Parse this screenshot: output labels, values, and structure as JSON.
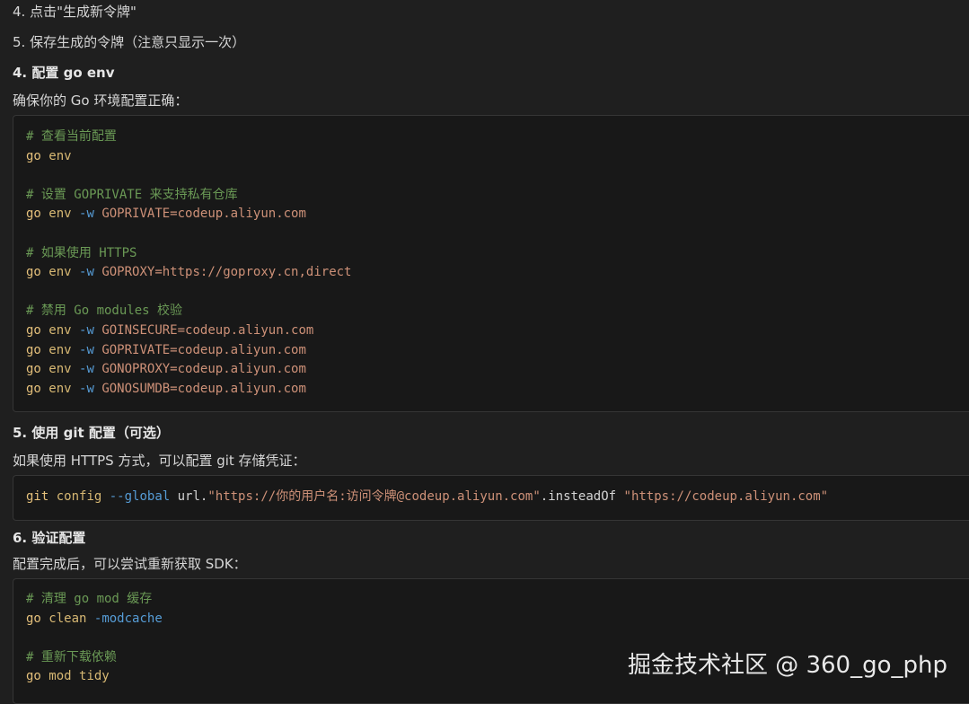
{
  "steps_top": [
    "4. 点击\"生成新令牌\"",
    "5. 保存生成的令牌（注意只显示一次）"
  ],
  "sections": {
    "goenv": {
      "heading": "4. 配置 go env",
      "intro": "确保你的 Go 环境配置正确：",
      "lines": [
        {
          "type": "comment",
          "text": "# 查看当前配置"
        },
        {
          "type": "cmd",
          "kw": "go",
          "sub": "env",
          "flag": "",
          "arg": ""
        },
        {
          "type": "blank"
        },
        {
          "type": "comment",
          "text": "# 设置 GOPRIVATE 来支持私有仓库"
        },
        {
          "type": "cmd",
          "kw": "go",
          "sub": "env",
          "flag": "-w",
          "arg": "GOPRIVATE=codeup.aliyun.com"
        },
        {
          "type": "blank"
        },
        {
          "type": "comment",
          "text": "# 如果使用 HTTPS"
        },
        {
          "type": "cmd",
          "kw": "go",
          "sub": "env",
          "flag": "-w",
          "arg": "GOPROXY=https://goproxy.cn,direct"
        },
        {
          "type": "blank"
        },
        {
          "type": "comment",
          "text": "# 禁用 Go modules 校验"
        },
        {
          "type": "cmd",
          "kw": "go",
          "sub": "env",
          "flag": "-w",
          "arg": "GOINSECURE=codeup.aliyun.com"
        },
        {
          "type": "cmd",
          "kw": "go",
          "sub": "env",
          "flag": "-w",
          "arg": "GOPRIVATE=codeup.aliyun.com"
        },
        {
          "type": "cmd",
          "kw": "go",
          "sub": "env",
          "flag": "-w",
          "arg": "GONOPROXY=codeup.aliyun.com"
        },
        {
          "type": "cmd",
          "kw": "go",
          "sub": "env",
          "flag": "-w",
          "arg": "GONOSUMDB=codeup.aliyun.com"
        }
      ]
    },
    "git": {
      "heading": "5. 使用 git 配置（可选）",
      "intro": "如果使用 HTTPS 方式，可以配置 git 存储凭证：",
      "cmd": {
        "kw": "git",
        "sub": "config",
        "flag": "--global",
        "plain1": "url.",
        "str1": "\"https://你的用户名:访问令牌@codeup.aliyun.com\"",
        "plain2": ".insteadOf",
        "str2": "\"https://codeup.aliyun.com\""
      }
    },
    "verify": {
      "heading": "6. 验证配置",
      "intro": "配置完成后，可以尝试重新获取 SDK：",
      "lines": [
        {
          "type": "comment",
          "text": "# 清理 go mod 缓存"
        },
        {
          "type": "cmd",
          "kw": "go",
          "sub": "clean",
          "flag": "-modcache",
          "arg": ""
        },
        {
          "type": "blank"
        },
        {
          "type": "comment",
          "text": "# 重新下载依赖"
        },
        {
          "type": "cmd",
          "kw": "go",
          "sub": "mod tidy",
          "flag": "",
          "arg": ""
        }
      ]
    }
  },
  "watermark": "掘金技术社区 @ 360_go_php"
}
